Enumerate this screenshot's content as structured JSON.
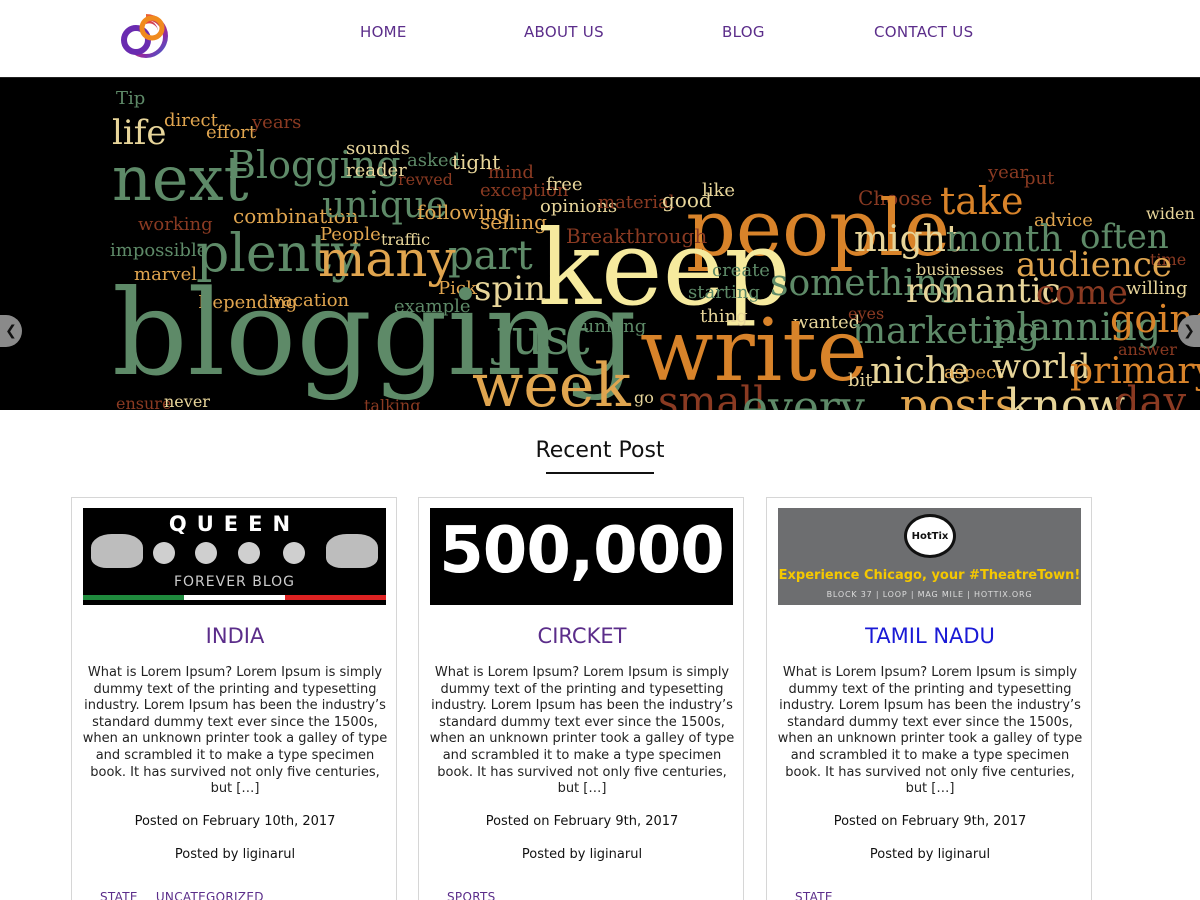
{
  "nav": {
    "items": [
      "HOME",
      "ABOUT US",
      "BLOG",
      "CONTACT US"
    ]
  },
  "slider": {
    "words": [
      {
        "t": "Tip",
        "c": "#5e8a68"
      },
      {
        "t": "life",
        "c": "#e7d59a"
      },
      {
        "t": "direct",
        "c": "#e0a54f"
      },
      {
        "t": "effort",
        "c": "#e0a54f"
      },
      {
        "t": "years",
        "c": "#8a3a22"
      },
      {
        "t": "next",
        "c": "#5e8a68"
      },
      {
        "t": "Blogging",
        "c": "#5e8a68"
      },
      {
        "t": "sounds",
        "c": "#e7d59a"
      },
      {
        "t": "reader",
        "c": "#e7d59a"
      },
      {
        "t": "asked",
        "c": "#5e8a68"
      },
      {
        "t": "revved",
        "c": "#8a3a22"
      },
      {
        "t": "tight",
        "c": "#e7d59a"
      },
      {
        "t": "mind",
        "c": "#8a3a22"
      },
      {
        "t": "exception",
        "c": "#8a3a22"
      },
      {
        "t": "free",
        "c": "#e7d59a"
      },
      {
        "t": "opinions",
        "c": "#e7d59a"
      },
      {
        "t": "material",
        "c": "#8a3a22"
      },
      {
        "t": "good",
        "c": "#e7d59a"
      },
      {
        "t": "like",
        "c": "#e7d59a"
      },
      {
        "t": "Choose",
        "c": "#8a3a22"
      },
      {
        "t": "year",
        "c": "#8a3a22"
      },
      {
        "t": "put",
        "c": "#8a3a22"
      },
      {
        "t": "widen",
        "c": "#e7d59a"
      },
      {
        "t": "working",
        "c": "#8a3a22"
      },
      {
        "t": "combination",
        "c": "#e0a54f"
      },
      {
        "t": "unique",
        "c": "#5e8a68"
      },
      {
        "t": "following",
        "c": "#e0a54f"
      },
      {
        "t": "selling",
        "c": "#e0a54f"
      },
      {
        "t": "people",
        "c": "#d8832a"
      },
      {
        "t": "take",
        "c": "#d8832a"
      },
      {
        "t": "advice",
        "c": "#e0a54f"
      },
      {
        "t": "often",
        "c": "#5e8a68"
      },
      {
        "t": "impossible",
        "c": "#5e8a68"
      },
      {
        "t": "plenty",
        "c": "#5e8a68"
      },
      {
        "t": "People",
        "c": "#e0a54f"
      },
      {
        "t": "traffic",
        "c": "#e7d59a"
      },
      {
        "t": "part",
        "c": "#5e8a68"
      },
      {
        "t": "Breakthrough",
        "c": "#8a3a22"
      },
      {
        "t": "might",
        "c": "#e7d59a"
      },
      {
        "t": "month",
        "c": "#5e8a68"
      },
      {
        "t": "time",
        "c": "#8a3a22"
      },
      {
        "t": "marvel",
        "c": "#e0a54f"
      },
      {
        "t": "many",
        "c": "#e0a54f"
      },
      {
        "t": "keep",
        "c": "#f6ea9e"
      },
      {
        "t": "create",
        "c": "#5e8a68"
      },
      {
        "t": "businesses",
        "c": "#e7d59a"
      },
      {
        "t": "audience",
        "c": "#e0a54f"
      },
      {
        "t": "Pick",
        "c": "#e0a54f"
      },
      {
        "t": "spin",
        "c": "#e7d59a"
      },
      {
        "t": "starting",
        "c": "#5e8a68"
      },
      {
        "t": "something",
        "c": "#5e8a68"
      },
      {
        "t": "romantic",
        "c": "#e7d59a"
      },
      {
        "t": "come",
        "c": "#8a3a22"
      },
      {
        "t": "willing",
        "c": "#e7d59a"
      },
      {
        "t": "Depending",
        "c": "#e0a54f"
      },
      {
        "t": "vacation",
        "c": "#e0a54f"
      },
      {
        "t": "example",
        "c": "#5e8a68"
      },
      {
        "t": "blogging",
        "c": "#5e8a68"
      },
      {
        "t": "just",
        "c": "#5e8a68"
      },
      {
        "t": "running",
        "c": "#5e8a68"
      },
      {
        "t": "thing",
        "c": "#e7d59a"
      },
      {
        "t": "wanted",
        "c": "#e7d59a"
      },
      {
        "t": "eyes",
        "c": "#8a3a22"
      },
      {
        "t": "marketing",
        "c": "#5e8a68"
      },
      {
        "t": "planning",
        "c": "#5e8a68"
      },
      {
        "t": "going",
        "c": "#d8832a"
      },
      {
        "t": "answer",
        "c": "#8a3a22"
      },
      {
        "t": "write",
        "c": "#d8832a"
      },
      {
        "t": "niche",
        "c": "#e7d59a"
      },
      {
        "t": "aspect",
        "c": "#e0a54f"
      },
      {
        "t": "world",
        "c": "#e7d59a"
      },
      {
        "t": "primary",
        "c": "#d8832a"
      },
      {
        "t": "bit",
        "c": "#e7d59a"
      },
      {
        "t": "week",
        "c": "#e0a54f"
      },
      {
        "t": "ensure",
        "c": "#8a3a22"
      },
      {
        "t": "never",
        "c": "#e7d59a"
      },
      {
        "t": "talking",
        "c": "#8a3a22"
      },
      {
        "t": "go",
        "c": "#e7d59a"
      },
      {
        "t": "small",
        "c": "#8a3a22"
      },
      {
        "t": "every",
        "c": "#5e8a68"
      },
      {
        "t": "posts",
        "c": "#e0a54f"
      },
      {
        "t": "know",
        "c": "#e7d59a"
      },
      {
        "t": "day",
        "c": "#8a3a22"
      }
    ]
  },
  "recent": {
    "title": "Recent Post"
  },
  "posts": [
    {
      "title": "INDIA",
      "thumb": {
        "heading": "QUEEN",
        "sub": "FOREVER BLOG"
      },
      "excerpt": "What is Lorem Ipsum? Lorem Ipsum is simply dummy text of the printing and typesetting industry. Lorem Ipsum has been the industry’s standard dummy text ever since the 1500s, when an unknown printer took a galley of type and scrambled it to make a type specimen book. It has survived not only five centuries, but […]",
      "date": "Posted on February 10th, 2017",
      "author": "Posted by liginarul",
      "categories": [
        "STATE",
        "UNCATEGORIZED"
      ]
    },
    {
      "title": "CIRCKET",
      "thumb": {
        "heading": "500,000"
      },
      "excerpt": "What is Lorem Ipsum? Lorem Ipsum is simply dummy text of the printing and typesetting industry. Lorem Ipsum has been the industry’s standard dummy text ever since the 1500s, when an unknown printer took a galley of type and scrambled it to make a type specimen book. It has survived not only five centuries, but […]",
      "date": "Posted on February 9th, 2017",
      "author": "Posted by liginarul",
      "categories": [
        "SPORTS"
      ]
    },
    {
      "title": "TAMIL NADU",
      "thumb": {
        "badge": "HotTix",
        "tagline": "Experience Chicago, your #TheatreTown!",
        "sub": "BLOCK 37 | LOOP | MAG MILE | HOTTIX.ORG"
      },
      "excerpt": "What is Lorem Ipsum? Lorem Ipsum is simply dummy text of the printing and typesetting industry. Lorem Ipsum has been the industry’s standard dummy text ever since the 1500s, when an unknown printer took a galley of type and scrambled it to make a type specimen book. It has survived not only five centuries, but […]",
      "date": "Posted on February 9th, 2017",
      "author": "Posted by liginarul",
      "categories": [
        "STATE"
      ]
    }
  ]
}
